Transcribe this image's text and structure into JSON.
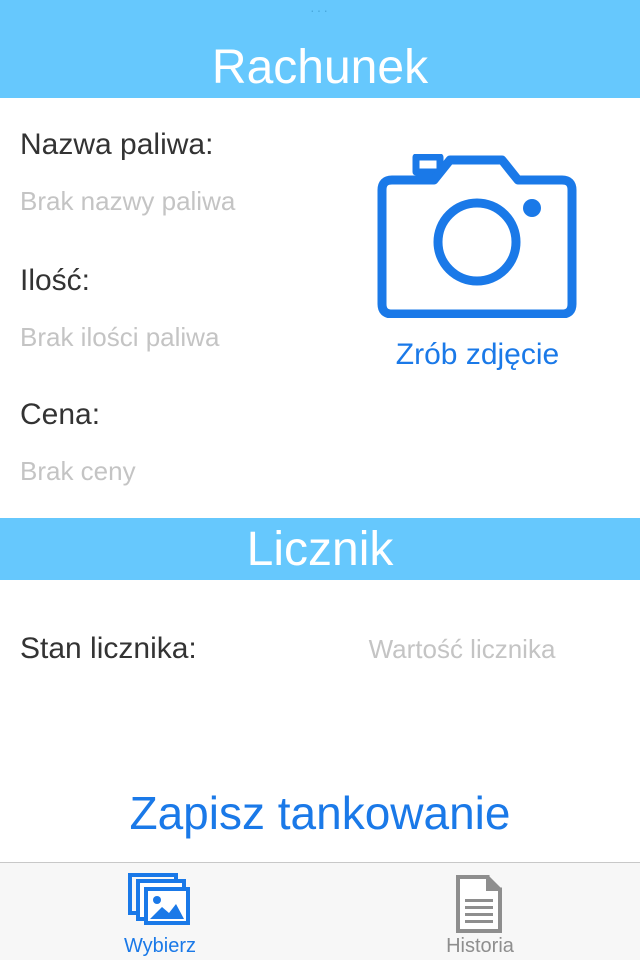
{
  "status_bar": {
    "dots": "···"
  },
  "receipt_section": {
    "title": "Rachunek",
    "fuel_name": {
      "label": "Nazwa paliwa:",
      "value": "Brak nazwy paliwa"
    },
    "quantity": {
      "label": "Ilość:",
      "value": "Brak ilości paliwa"
    },
    "price": {
      "label": "Cena:",
      "value": "Brak ceny"
    },
    "camera": {
      "icon": "camera-icon",
      "label": "Zrób zdjęcie"
    }
  },
  "meter_section": {
    "title": "Licznik",
    "label": "Stan licznika:",
    "placeholder": "Wartość licznika",
    "value": ""
  },
  "save_button_label": "Zapisz tankowanie",
  "tab_bar": {
    "tabs": [
      {
        "label": "Wybierz",
        "icon": "photo-library-icon",
        "selected": true
      },
      {
        "label": "Historia",
        "icon": "document-icon",
        "selected": false
      }
    ]
  },
  "colors": {
    "header_background": "#66c8fd",
    "accent": "#1a79e8",
    "placeholder_text": "#c4c4c4",
    "label_text": "#333333",
    "tab_inactive": "#8e8e8e"
  }
}
